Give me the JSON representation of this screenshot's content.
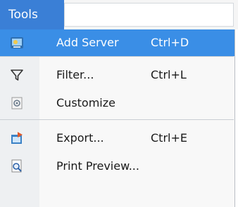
{
  "menubar": {
    "title": "Tools"
  },
  "menu": {
    "items": [
      {
        "label": "Add Server",
        "shortcut": "Ctrl+D",
        "icon": "add-server-icon"
      },
      {
        "label": "Filter...",
        "shortcut": "Ctrl+L",
        "icon": "filter-icon"
      },
      {
        "label": "Customize",
        "icon": "customize-icon"
      },
      {
        "label": "Export...",
        "shortcut": "Ctrl+E",
        "icon": "export-icon"
      },
      {
        "label": "Print Preview...",
        "icon": "print-preview-icon"
      }
    ]
  },
  "colors": {
    "accent": "#3a7fd6",
    "selected": "#3a8ee6"
  }
}
